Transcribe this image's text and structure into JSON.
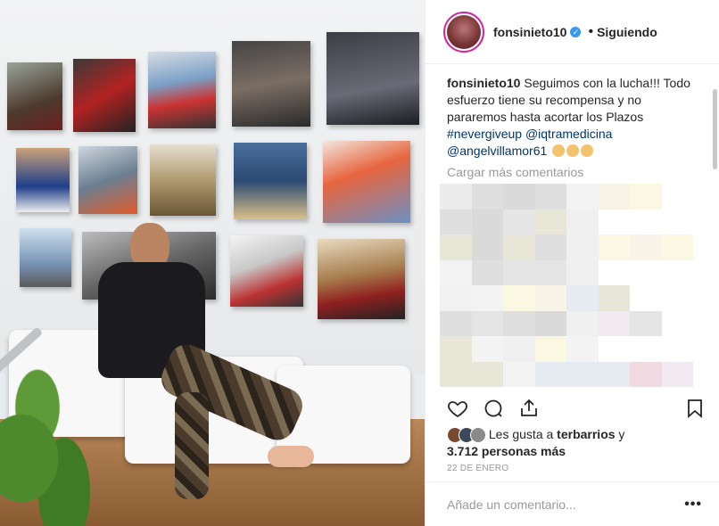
{
  "header": {
    "username": "fonsinieto10",
    "separator": "•",
    "follow_label": "Siguiendo",
    "verified_glyph": "✓"
  },
  "caption": {
    "username": "fonsinieto10",
    "text": "Seguimos con la lucha!!! Todo esfuerzo tiene su recompensa y no pararemos hasta acortar los Plazos",
    "hashtag": "#nevergiveup",
    "mention1": "@iqtramedicina",
    "mention2": "@angelvillamor61"
  },
  "comments": {
    "load_more": "Cargar más comentarios"
  },
  "likes": {
    "prefix": "Les gusta a",
    "first_user": "terbarrios",
    "joiner": "y",
    "others": "3.712 personas más"
  },
  "date": "22 DE ENERO",
  "comment_input": {
    "placeholder": "Añade un comentario..."
  },
  "icons": {
    "like": "heart-icon",
    "comment": "comment-icon",
    "share": "share-icon",
    "save": "bookmark-icon",
    "more": "more-options-icon"
  },
  "colors": {
    "link": "#003569",
    "verified": "#3897f0",
    "muted": "#999999"
  }
}
